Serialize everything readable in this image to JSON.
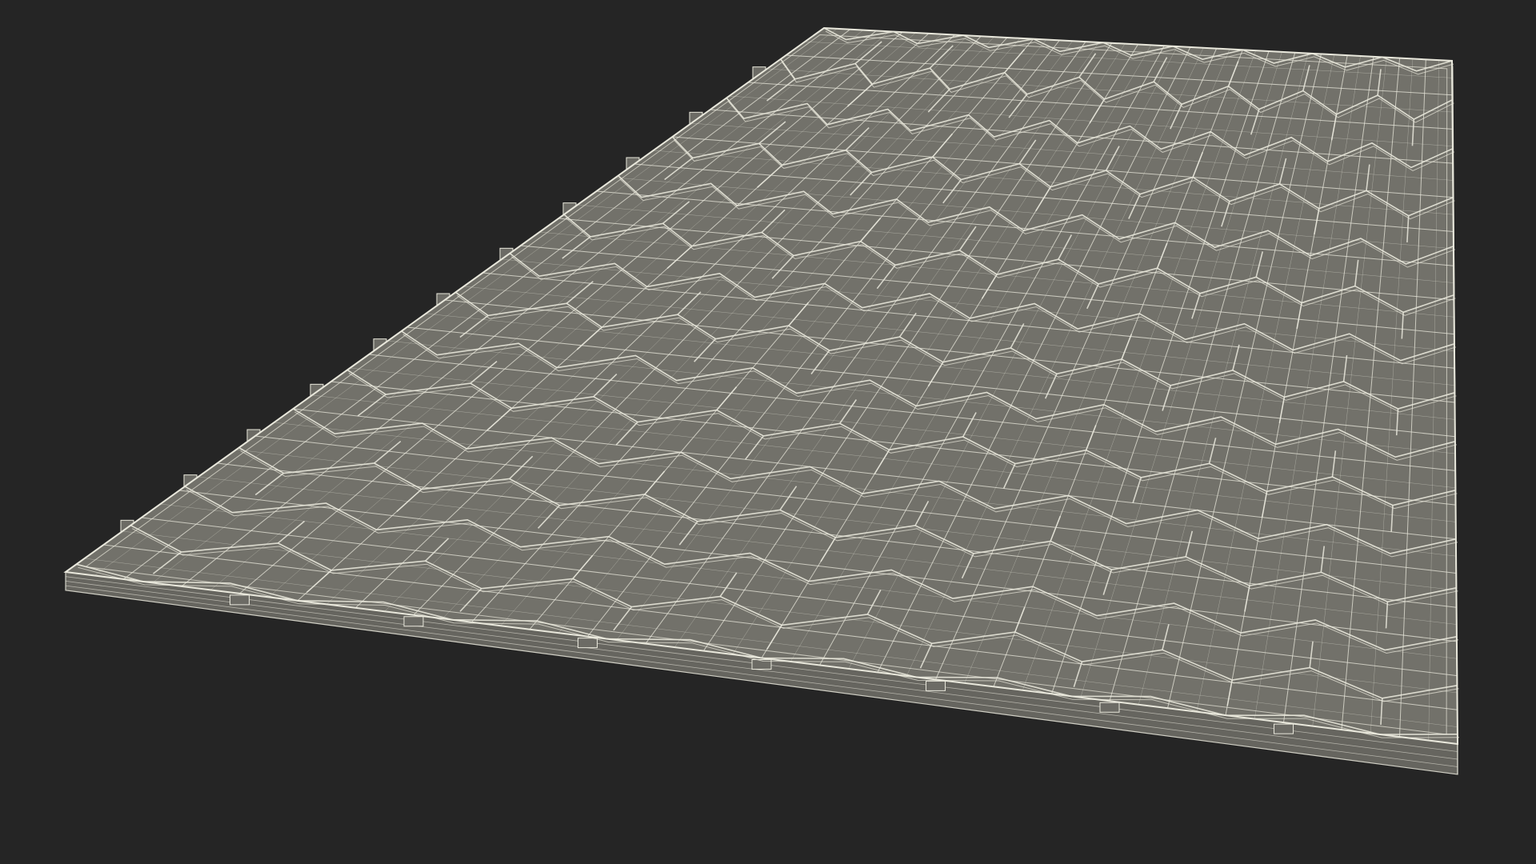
{
  "scene": {
    "background_color": "#252525",
    "surface_color": "#72716a",
    "side_color": "#66655f",
    "wire_color": "#e9e8dc",
    "grid_columns": 24,
    "grid_rows": 20,
    "pattern": "hexagonal-wave-tiles",
    "render_mode": "wireframe-on-shaded"
  }
}
